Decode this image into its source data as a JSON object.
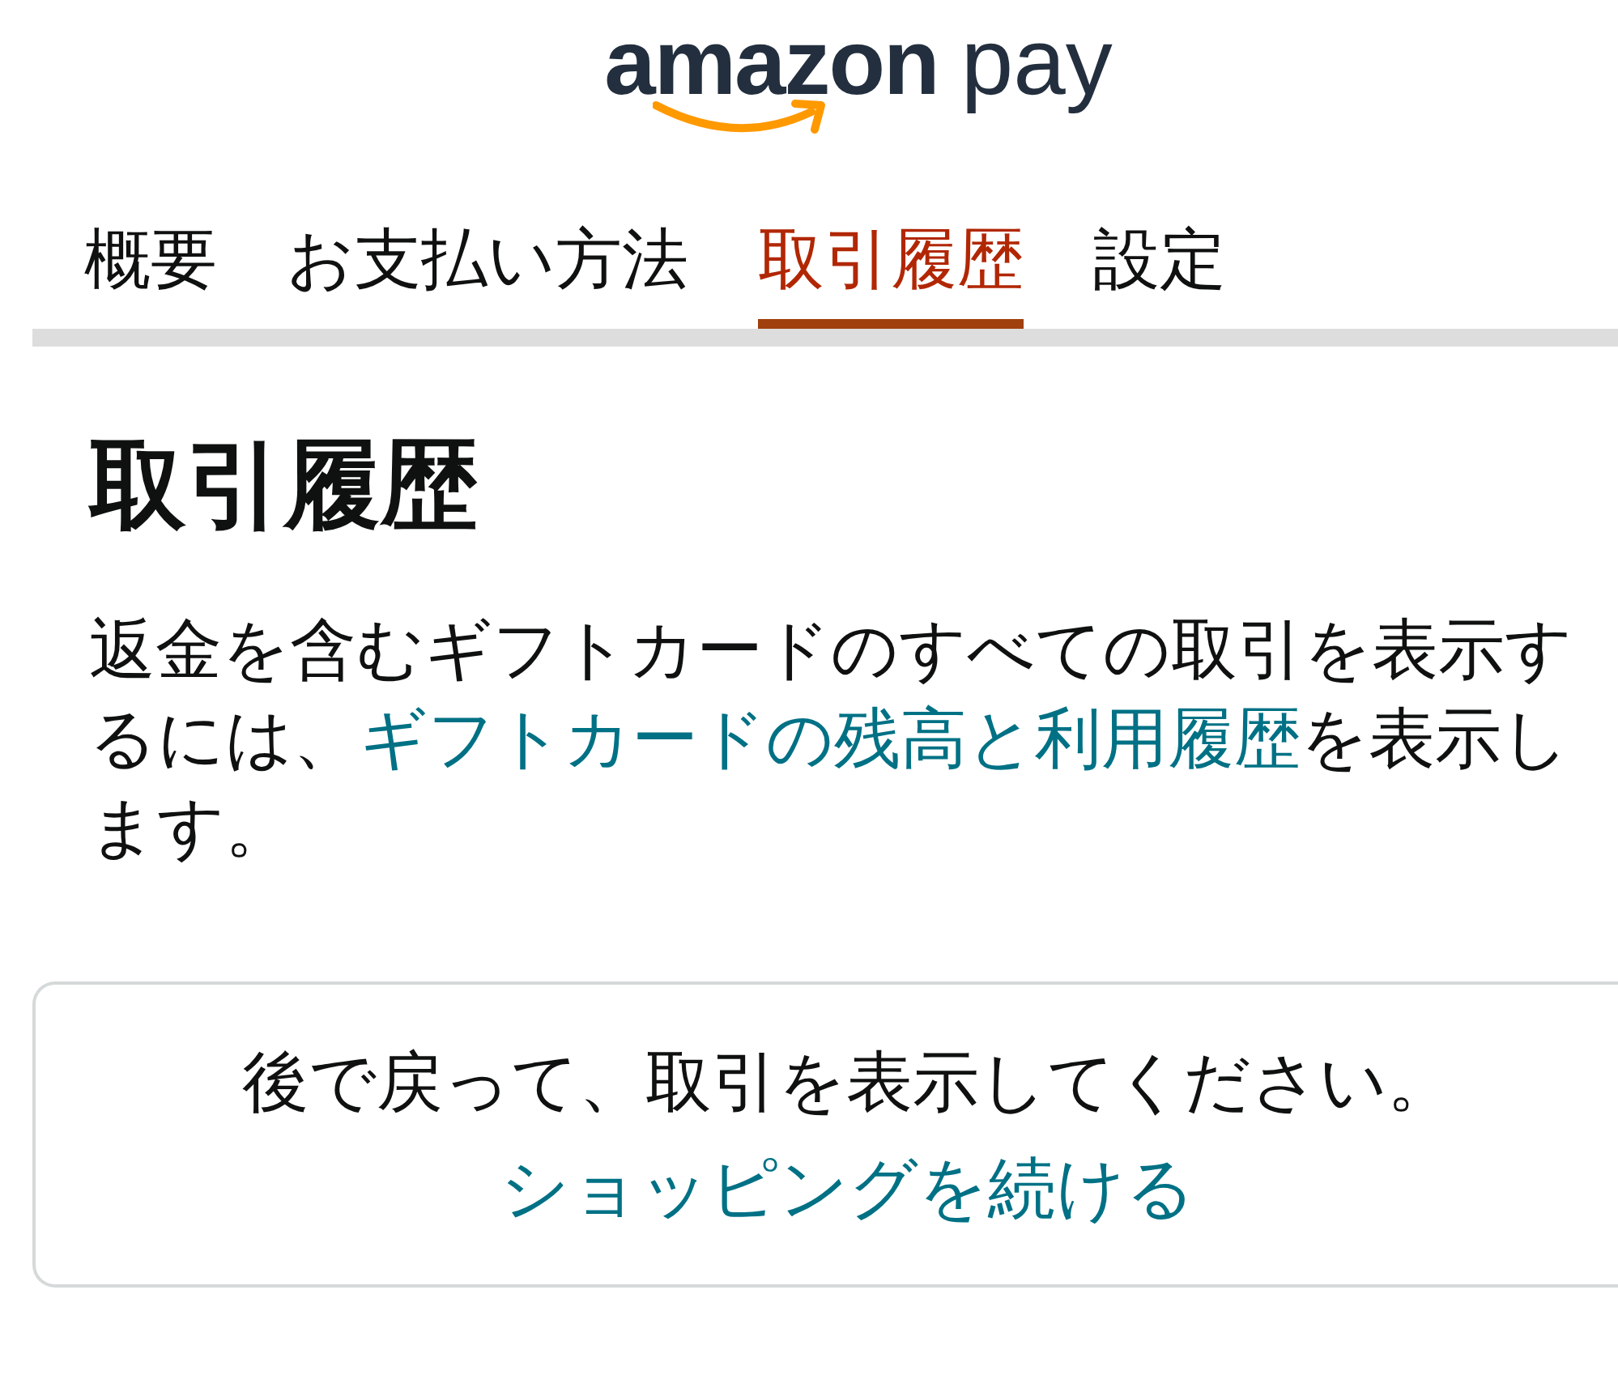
{
  "logo": {
    "brand": "amazon",
    "product": "pay"
  },
  "tabs": [
    {
      "label": "概要",
      "selected": false
    },
    {
      "label": "お支払い方法",
      "selected": false
    },
    {
      "label": "取引履歴",
      "selected": true
    },
    {
      "label": "設定",
      "selected": false
    }
  ],
  "heading": "取引履歴",
  "intro": {
    "text_before": "返金を含むギフトカードのすべての取引を表示するには、",
    "link": "ギフトカードの残高と利用履歴",
    "text_after": "を表示します。"
  },
  "notice": {
    "message": "後で戻って、取引を表示してください。",
    "link": "ショッピングを続ける"
  }
}
